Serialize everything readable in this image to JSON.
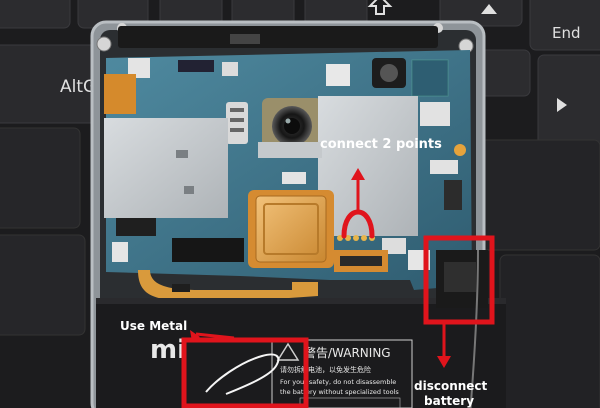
{
  "keyboard": {
    "alt_key": "AltG",
    "end_key": "End"
  },
  "annotations": {
    "connect_points": "connect 2 points",
    "use_metal": "Use Metal",
    "disconnect_line1": "disconnect",
    "disconnect_line2": "battery"
  },
  "battery_label": {
    "logo": "mi",
    "warning_title": "警告/WARNING",
    "warning_cn": "请勿拆解电池，以免发生危险",
    "warning_en1": "For your safety, do not disassemble",
    "warning_en2": "the battery without specialized tools"
  },
  "colors": {
    "annotation_red": "#e0141c",
    "pcb_blue": "#3d6f86",
    "shield_silver": "#c9cdd0",
    "flex_orange": "#d98a2a",
    "battery_black": "#1b1b1d"
  }
}
